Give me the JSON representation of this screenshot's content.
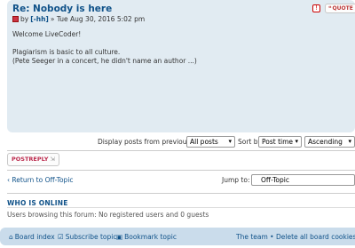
{
  "post": {
    "title": "Re: Nobody is here",
    "by": "by",
    "author": "[-hh]",
    "date": "» Tue Aug 30, 2016 5:02 pm",
    "body_line1": "Welcome LiveCoder!",
    "body_line2": "Plagiarism is basic to all culture.",
    "body_line3": "(Pete Seeger in a concert, he didn't name an author ...)",
    "report_icon": "!",
    "quote_label": "QUOTE"
  },
  "sort_bar": {
    "display_label": "Display posts from previous:",
    "display_value": "All posts",
    "sort_label": "Sort by",
    "sort_value": "Post time",
    "order_value": "Ascending"
  },
  "actions": {
    "postreply_label": "POSTREPLY",
    "return_link": "‹ Return to Off-Topic",
    "jump_label": "Jump to:",
    "jump_value": "Off-Topic"
  },
  "online": {
    "title": "WHO IS ONLINE",
    "text": "Users browsing this forum: No registered users and 0 guests"
  },
  "footer": {
    "board_index": "Board index",
    "subscribe_topic": "Subscribe topic",
    "bookmark_topic": "Bookmark topic",
    "right_links": "The team • Delete all board cookies •"
  },
  "colors": {
    "accent": "#105289",
    "panel": "#e1ebf2",
    "footer": "#cadceb",
    "reply": "#bc2a4d"
  }
}
